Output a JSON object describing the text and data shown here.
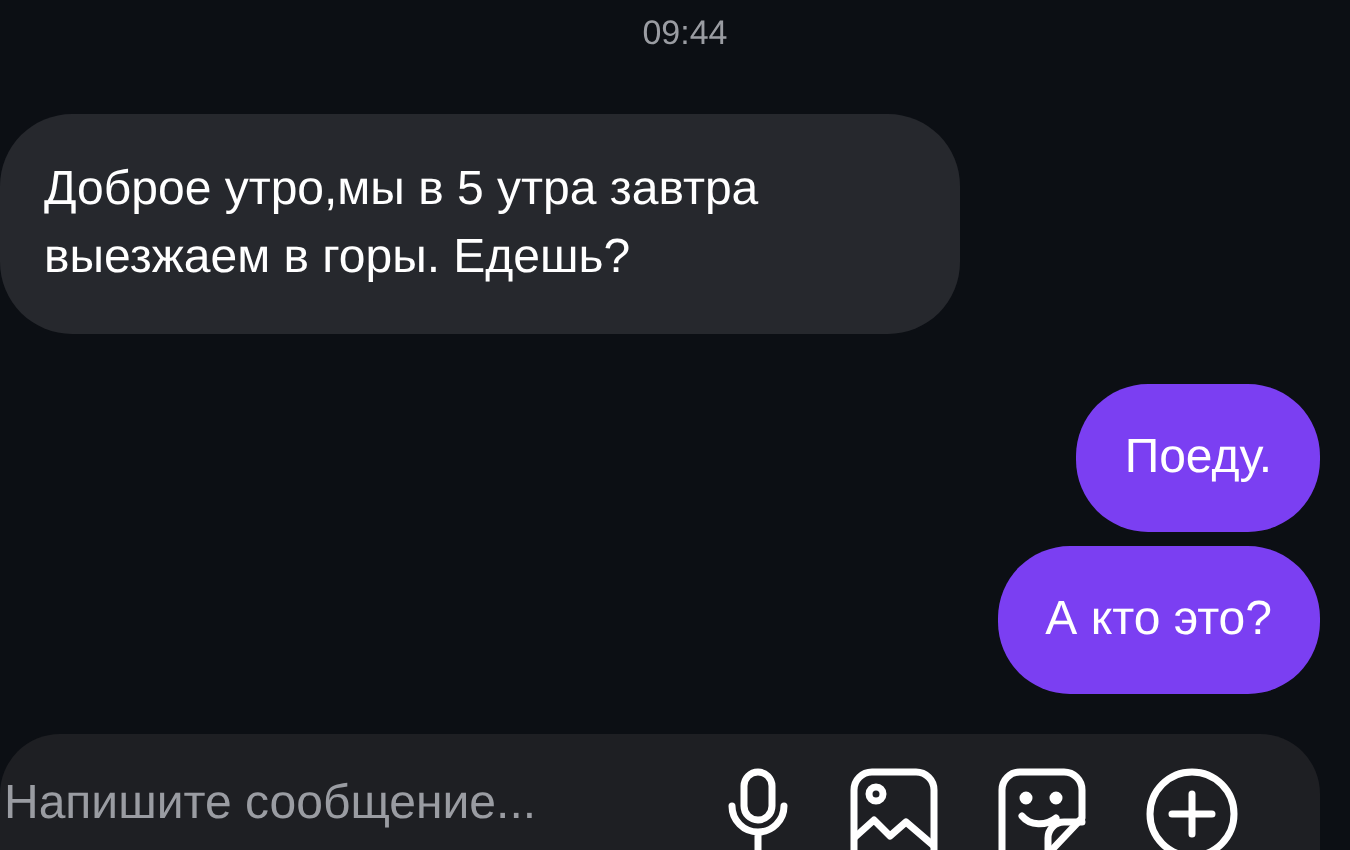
{
  "timestamp": "09:44",
  "messages": [
    {
      "kind": "incoming",
      "text": "Доброе утро,мы в 5 утра завтра выезжаем в горы. Едешь?"
    },
    {
      "kind": "outgoing",
      "text": "Поеду."
    },
    {
      "kind": "outgoing",
      "text": "А кто это?"
    }
  ],
  "composer": {
    "placeholder": "Напишите сообщение..."
  }
}
